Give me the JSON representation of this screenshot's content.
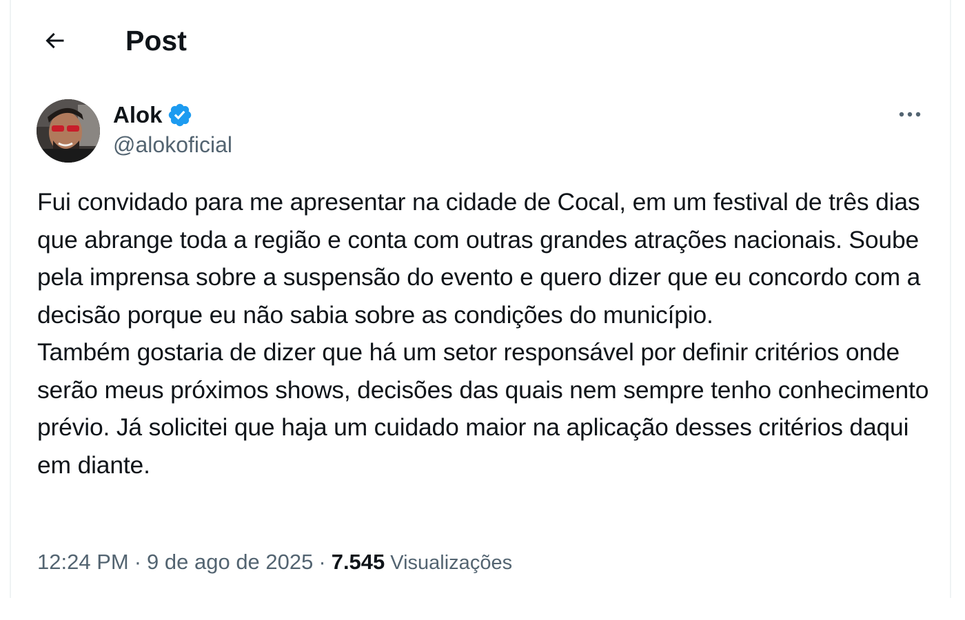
{
  "header": {
    "back_icon": "arrow-left-icon",
    "title": "Post"
  },
  "author": {
    "name": "Alok",
    "verified_icon": "verified-badge-icon",
    "handle": "@alokoficial",
    "more_icon": "more-horizontal-icon"
  },
  "post": {
    "text": "Fui convidado para me apresentar na cidade de Cocal, em um festival de três dias que abrange toda a região e conta com outras grandes atrações nacionais. Soube pela imprensa sobre a suspensão do evento e quero dizer que eu concordo com a decisão porque eu não sabia sobre as condições do município.\nTambém gostaria de dizer que há um setor responsável por definir critérios onde serão meus próximos shows, decisões das quais nem sempre tenho conhecimento prévio. Já solicitei que haja um cuidado maior na aplicação desses critérios daqui em diante."
  },
  "meta": {
    "time": "12:24 PM",
    "separator": "·",
    "date": "9 de ago de 2025",
    "views_count": "7.545",
    "views_label": "Visualizações"
  },
  "colors": {
    "text_primary": "#0f1419",
    "text_secondary": "#536471",
    "verified_blue": "#1d9bf0",
    "border": "#eff3f4"
  }
}
